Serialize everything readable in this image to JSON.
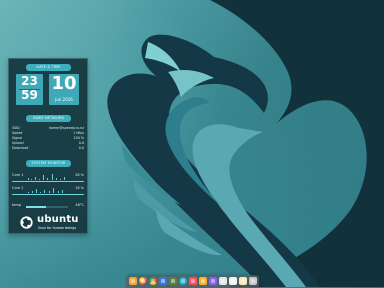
{
  "desktop": {
    "accent_color": "#3daebb",
    "panel_color": "#14363d",
    "text_color": "#d9f1f2"
  },
  "widget": {
    "date_time_header": "DATE & TIME",
    "network_header": "SWEE NETWORK",
    "monitor_header": "SYSTEM MONITOR",
    "clock_hour": "23",
    "clock_minute": "59",
    "date_day": "10",
    "date_monthyear": "Jun 2016",
    "network": [
      {
        "label": "SSID",
        "value": "homer@speedy.co.nz"
      },
      {
        "label": "Speed",
        "value": "1 Mb/s"
      },
      {
        "label": "Signal",
        "value": "100 %"
      },
      {
        "label": "Upload",
        "value": "0.0"
      },
      {
        "label": "Download",
        "value": "0.0"
      }
    ],
    "monitor": [
      {
        "label": "Core 1",
        "value": "28 %"
      },
      {
        "label": "Core 2",
        "value": "16 %"
      },
      {
        "label": "temp",
        "value": "48°C"
      }
    ],
    "ubuntu_name": "ubuntu",
    "ubuntu_tagline": "linux for human beings"
  },
  "dock": {
    "icons": [
      "home-icon",
      "firefox-icon",
      "chrome-icon",
      "mail-icon",
      "slack-icon",
      "camera-icon",
      "player-icon",
      "chat-icon",
      "music-icon",
      "monitor-icon",
      "files-icon",
      "notes-icon",
      "trash-icon"
    ]
  }
}
